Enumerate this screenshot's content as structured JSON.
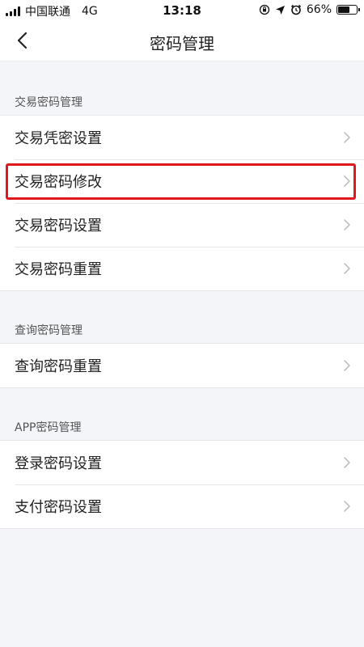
{
  "status_bar": {
    "carrier": "中国联通",
    "network": "4G",
    "time": "13:18",
    "battery": "66%",
    "battery_level": 0.66
  },
  "nav": {
    "title": "密码管理",
    "back_icon": "chevron-left-icon"
  },
  "sections": [
    {
      "header": "交易密码管理",
      "items": [
        {
          "label": "交易凭密设置"
        },
        {
          "label": "交易密码修改",
          "highlighted": true
        },
        {
          "label": "交易密码设置"
        },
        {
          "label": "交易密码重置"
        }
      ]
    },
    {
      "header": "查询密码管理",
      "items": [
        {
          "label": "查询密码重置"
        }
      ]
    },
    {
      "header": "APP密码管理",
      "items": [
        {
          "label": "登录密码设置"
        },
        {
          "label": "支付密码设置"
        }
      ]
    }
  ],
  "colors": {
    "highlight_border": "#e0181e",
    "page_background": "#f4f5f9"
  }
}
